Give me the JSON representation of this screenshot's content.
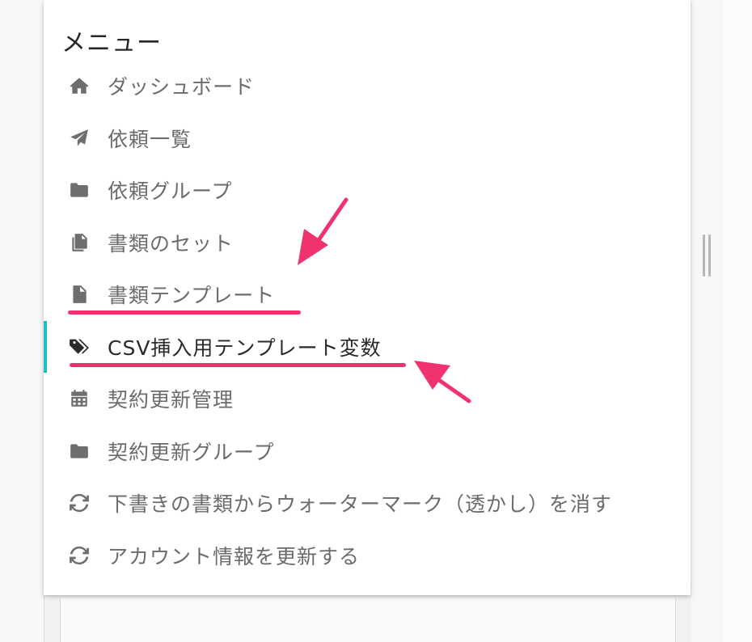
{
  "menu": {
    "title": "メニュー",
    "items": [
      {
        "label": "ダッシュボード",
        "icon": "home-icon"
      },
      {
        "label": "依頼一覧",
        "icon": "paper-plane-icon"
      },
      {
        "label": "依頼グループ",
        "icon": "folder-icon"
      },
      {
        "label": "書類のセット",
        "icon": "copy-icon"
      },
      {
        "label": "書類テンプレート",
        "icon": "file-icon"
      },
      {
        "label": "CSV挿入用テンプレート変数",
        "icon": "tags-icon",
        "active": true
      },
      {
        "label": "契約更新管理",
        "icon": "calendar-icon"
      },
      {
        "label": "契約更新グループ",
        "icon": "folder-icon"
      },
      {
        "label": "下書きの書類からウォーターマーク（透かし）を消す",
        "icon": "sync-icon"
      },
      {
        "label": "アカウント情報を更新する",
        "icon": "sync-icon"
      }
    ]
  },
  "colors": {
    "accent": "#1fbfc7",
    "annotation": "#f0336f",
    "text_active": "#2a2a2a",
    "text_inactive": "#6b6b6b"
  }
}
